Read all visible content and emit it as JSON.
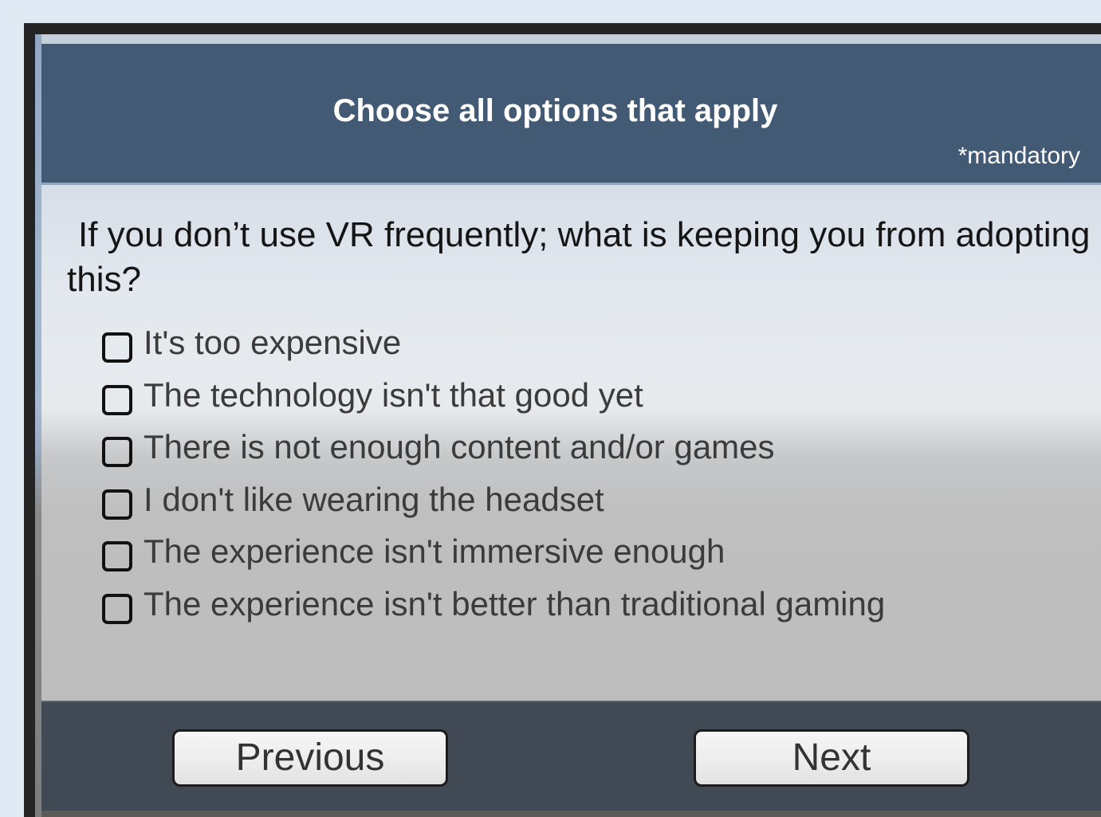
{
  "header": {
    "title": "Choose all options that apply",
    "mandatory_note": "*mandatory"
  },
  "question": {
    "text": "If you don’t use VR frequently; what is keeping you from adopting this?"
  },
  "options": [
    {
      "label": "It's too expensive",
      "checked": false
    },
    {
      "label": "The technology isn't that good yet",
      "checked": false
    },
    {
      "label": "There is not enough content and/or games",
      "checked": false
    },
    {
      "label": "I don't like wearing the headset",
      "checked": false
    },
    {
      "label": "The experience isn't immersive enough",
      "checked": false
    },
    {
      "label": "The experience isn't better than traditional gaming",
      "checked": false
    }
  ],
  "footer": {
    "previous_label": "Previous",
    "next_label": "Next"
  }
}
